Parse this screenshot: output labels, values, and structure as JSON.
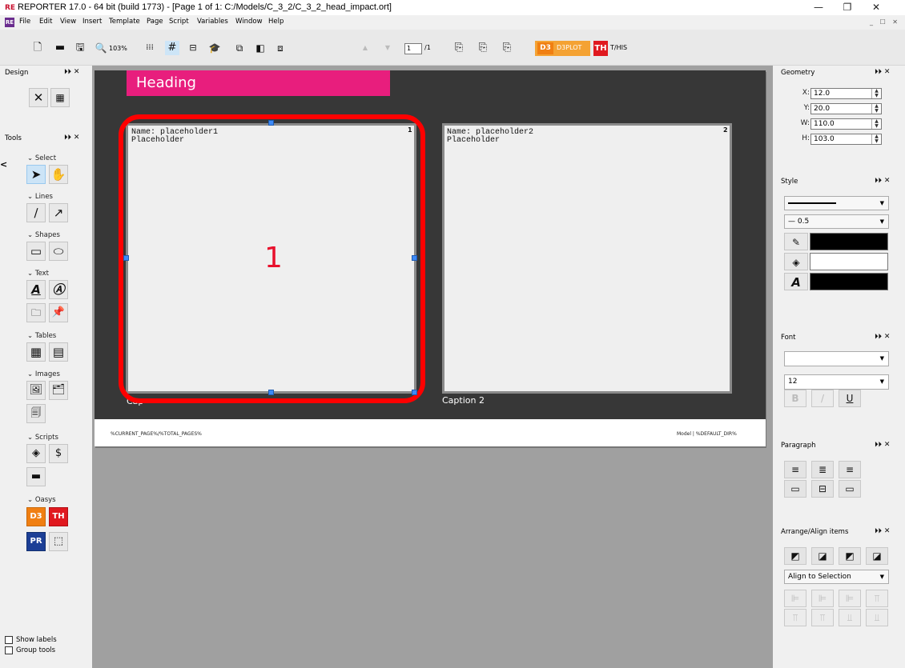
{
  "window": {
    "title": "REPORTER 17.0 - 64 bit (build 1773) - [Page 1 of 1: C:/Models/C_3_2/C_3_2_head_impact.ort]",
    "logo": "RE",
    "minimize": "—",
    "restore": "❐",
    "close": "✕"
  },
  "menu": {
    "logo": "RE",
    "items": [
      "File",
      "Edit",
      "View",
      "Insert",
      "Template",
      "Page",
      "Script",
      "Variables",
      "Window",
      "Help"
    ],
    "window_controls": "_ ☐ ✕"
  },
  "toolbar": {
    "zoom_label": "103%",
    "page_value": "1",
    "page_total": "/1",
    "d3_badge": "D3",
    "d3_label": "D3PLOT",
    "th_badge": "TH",
    "th_label": "T/HIS",
    "icons": [
      "new-file-icon",
      "open-folder-icon",
      "save-icon",
      "zoom-icon",
      "dot-grid-icon",
      "grid-icon",
      "snap-icon",
      "graduation-cap-icon",
      "page-first-icon",
      "page-prev-icon",
      "page-view-icon",
      "up-arrow-icon",
      "down-arrow-icon",
      "add-page-icon",
      "add-page-2-icon",
      "add-page-3-icon"
    ]
  },
  "left_panel": {
    "design_header": "Design",
    "tools_header": "Tools",
    "sections": [
      "Select",
      "Lines",
      "Shapes",
      "Text",
      "Tables",
      "Images",
      "Scripts",
      "Oasys"
    ],
    "show_labels": "Show labels",
    "group_tools": "Group tools",
    "oasys": {
      "d3": "D3",
      "th": "TH",
      "pr": "PR"
    }
  },
  "page": {
    "heading": "Heading",
    "placeholder1": {
      "text": "Name: placeholder1\nPlaceholder",
      "number": "1",
      "caption": "Cap"
    },
    "placeholder2": {
      "text": "Name: placeholder2\nPlaceholder",
      "number": "2",
      "caption": "Caption 2"
    },
    "annotation_number": "1",
    "footer_left": "%CURRENT_PAGE%/%TOTAL_PAGES%",
    "footer_right": "Model | %DEFAULT_DIR%"
  },
  "right_panel": {
    "geometry": {
      "header": "Geometry",
      "x_label": "X:",
      "x_value": "12.0",
      "y_label": "Y:",
      "y_value": "20.0",
      "w_label": "W:",
      "w_value": "110.0",
      "h_label": "H:",
      "h_value": "103.0"
    },
    "style": {
      "header": "Style",
      "line_width": "0.5",
      "line_color": "#000000",
      "fill_color": "#ffffff",
      "text_color": "#000000"
    },
    "font": {
      "header": "Font",
      "family": "",
      "size": "12",
      "bold": "B",
      "italic": "/",
      "underline": "U"
    },
    "paragraph": {
      "header": "Paragraph"
    },
    "arrange": {
      "header": "Arrange/Align items",
      "align_to": "Align to Selection"
    }
  },
  "colors": {
    "heading_bg": "#e81e7d",
    "page_dark": "#373737",
    "annotation": "#ff0000",
    "canvas_bg": "#a0a0a0"
  }
}
